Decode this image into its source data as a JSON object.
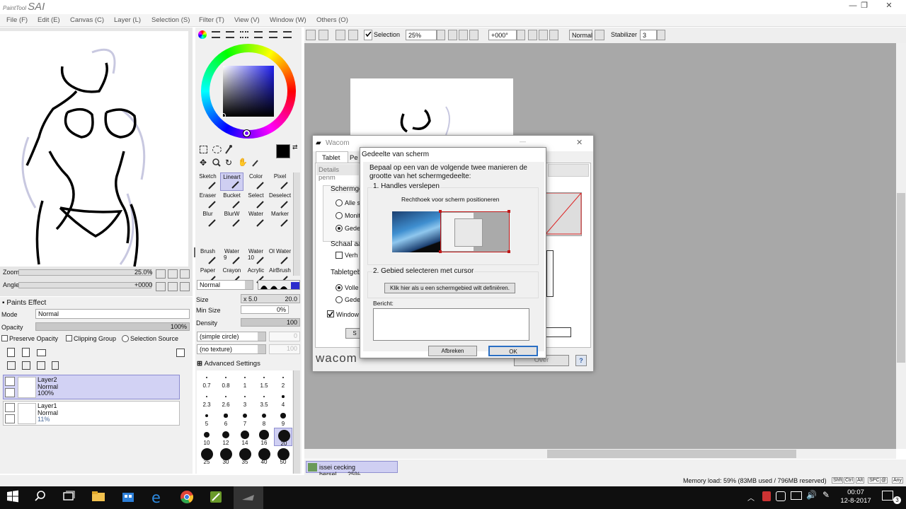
{
  "app": {
    "logo_small": "PaintTool",
    "logo": "SAI"
  },
  "window_controls": {
    "minimize": "—",
    "restore": "❐",
    "close": "✕"
  },
  "menu": [
    "File (F)",
    "Edit (E)",
    "Canvas (C)",
    "Layer (L)",
    "Selection (S)",
    "Filter (T)",
    "View (V)",
    "Window (W)",
    "Others (O)"
  ],
  "toolbar": {
    "selection_label": "Selection",
    "zoom": "25%",
    "rotation": "+000°",
    "blend": "Normal",
    "stabilizer_label": "Stabilizer",
    "stabilizer": "3"
  },
  "navigator": {
    "zoom_label": "Zoom",
    "zoom_value": "25.0%",
    "angle_label": "Angle",
    "angle_value": "+0000"
  },
  "layers": {
    "paints_effect": "Paints Effect",
    "mode_label": "Mode",
    "mode_value": "Normal",
    "opacity_label": "Opacity",
    "opacity_value": "100%",
    "preserve_opacity": "Preserve Opacity",
    "clipping_group": "Clipping Group",
    "selection_source": "Selection Source",
    "items": [
      {
        "name": "Layer2",
        "mode": "Normal",
        "opacity": "100%"
      },
      {
        "name": "Layer1",
        "mode": "Normal",
        "opacity": "11%"
      }
    ]
  },
  "tools": {
    "cells": [
      "Sketch",
      "Lineart",
      "Color",
      "Pixel",
      "Eraser",
      "Bucket",
      "Select",
      "Deselect",
      "Blur",
      "BlurW",
      "Water",
      "Marker",
      "",
      "",
      "",
      "",
      "Brush",
      "Water",
      "Water",
      "Ol Water",
      "Paper",
      "Crayon",
      "Acrylic",
      "AirBrush"
    ],
    "brush_sub": [
      "9",
      "10"
    ],
    "blend": "Normal",
    "size_label": "Size",
    "size_mult": "x 5.0",
    "size_value": "20.0",
    "minsize_label": "Min Size",
    "minsize_value": "0%",
    "density_label": "Density",
    "density_value": "100",
    "shape": "(simple circle)",
    "shape_value": "0",
    "texture": "(no texture)",
    "texture_value": "100",
    "advanced": "Advanced Settings",
    "brush_sizes": [
      "0.7",
      "0.8",
      "1",
      "1.5",
      "2",
      "2.3",
      "2.6",
      "3",
      "3.5",
      "4",
      "5",
      "6",
      "7",
      "8",
      "9",
      "10",
      "12",
      "14",
      "16",
      "20",
      "25",
      "30",
      "35",
      "40",
      "50"
    ]
  },
  "wacom": {
    "title": "Wacom",
    "tabs": [
      "Tablet",
      "Pe"
    ],
    "details": "Details penm",
    "screen_label": "Schermge",
    "radio1": "Alle s",
    "radio2": "Monit",
    "radio3": "Gede",
    "scale_label": "Schaal aa",
    "scale_check": "Verh",
    "tablet_label": "Tabletgeb",
    "tradio1": "Volle",
    "tradio2": "Gede",
    "windows_check": "Window",
    "over": "Over",
    "brand": "wacom",
    "help": "?",
    "s_btn": "S"
  },
  "dialog": {
    "title": "Gedeelte van scherm",
    "intro": "Bepaal op een van de volgende twee manieren de grootte van het schermgedeelte:",
    "section1": "1. Handles verslepen",
    "rect_label": "Rechthoek voor scherm positioneren",
    "section2": "2. Gebied selecteren met cursor",
    "click_button": "Klik hier als u een schermgebied wilt definiëren.",
    "message_label": "Bericht:",
    "cancel": "Afbreken",
    "ok": "OK"
  },
  "status": {
    "doc_name": "issei cecking hersel...",
    "doc_zoom": "25%",
    "memory": "Memory load: 59% (83MB used / 796MB reserved)",
    "keys": [
      "Shft",
      "Ctrl",
      "Alt",
      "SPC",
      "@",
      "Any"
    ]
  },
  "taskbar": {
    "time": "00:07",
    "date": "12-8-2017",
    "notif": "3"
  },
  "colors": {
    "accent": "#2d2dcc",
    "selected_tool": "#cfcff2",
    "canvas_bg": "#a8a8a8",
    "taskbar": "#0f0f0f"
  }
}
